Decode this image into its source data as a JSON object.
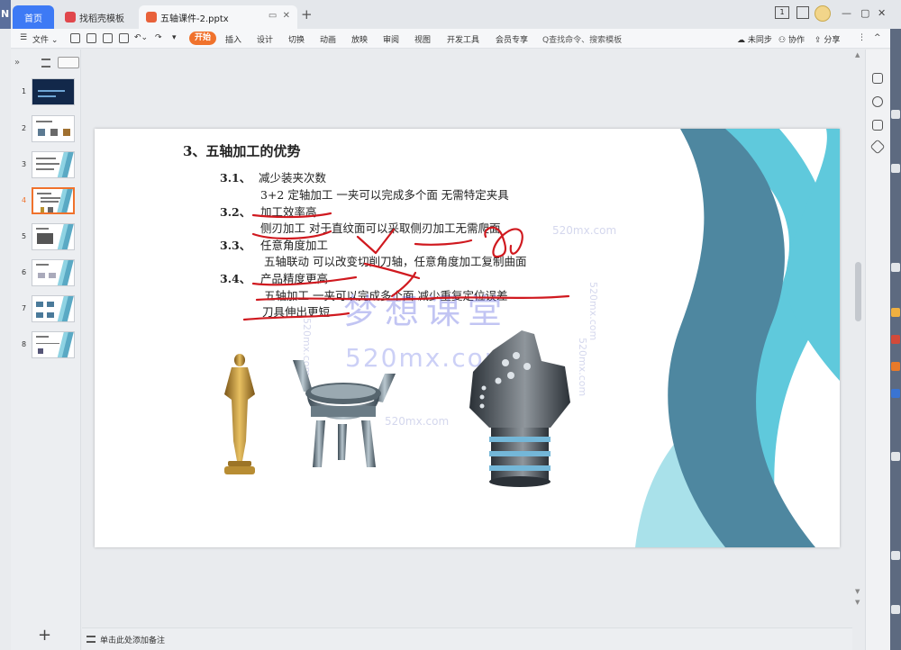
{
  "tabs": {
    "app_letter": "N",
    "home": "首页",
    "template": "找稻壳模板",
    "document": "五轴课件-2.pptx"
  },
  "window": {
    "layout_badge": "1"
  },
  "ribbon": {
    "file": "文件",
    "tabs": [
      "开始",
      "插入",
      "设计",
      "切换",
      "动画",
      "放映",
      "审阅",
      "视图",
      "开发工具",
      "会员专享"
    ],
    "search": "Q查找命令、搜索模板",
    "sync": "未同步",
    "collab": "协作",
    "share": "分享"
  },
  "thumbnails": {
    "numbers": [
      "1",
      "2",
      "3",
      "4",
      "5",
      "6",
      "7",
      "8"
    ],
    "active_index": 4
  },
  "slide": {
    "title": "3、五轴加工的优势",
    "items": [
      {
        "num": "3.1、",
        "heading": "减少装夹次数",
        "detail": "3+2 定轴加工 一夹可以完成多个面 无需特定夹具"
      },
      {
        "num": "3.2、",
        "heading": "加工效率高",
        "detail": "侧刃加工 对于直纹面可以采取侧刃加工无需爬面"
      },
      {
        "num": "3.3、",
        "heading": "任意角度加工",
        "detail": "五轴联动 可以改变切削刀轴，任意角度加工复制曲面"
      },
      {
        "num": "3.4、",
        "heading": "产品精度更高",
        "detail": "五轴加工 一夹可以完成多个面 减少重复定位误差",
        "detail2": "刀具伸出更短"
      }
    ],
    "watermark_main": "梦想课堂",
    "watermark_url": "520mx.com",
    "watermark_small": "520mx.com",
    "accent_colors": {
      "dark_teal": "#4e87a0",
      "light_teal": "#5fc9dc",
      "pale_teal": "#a9e1ea",
      "ink_red": "#d0191f"
    }
  },
  "notes": {
    "placeholder": "单击此处添加备注"
  }
}
